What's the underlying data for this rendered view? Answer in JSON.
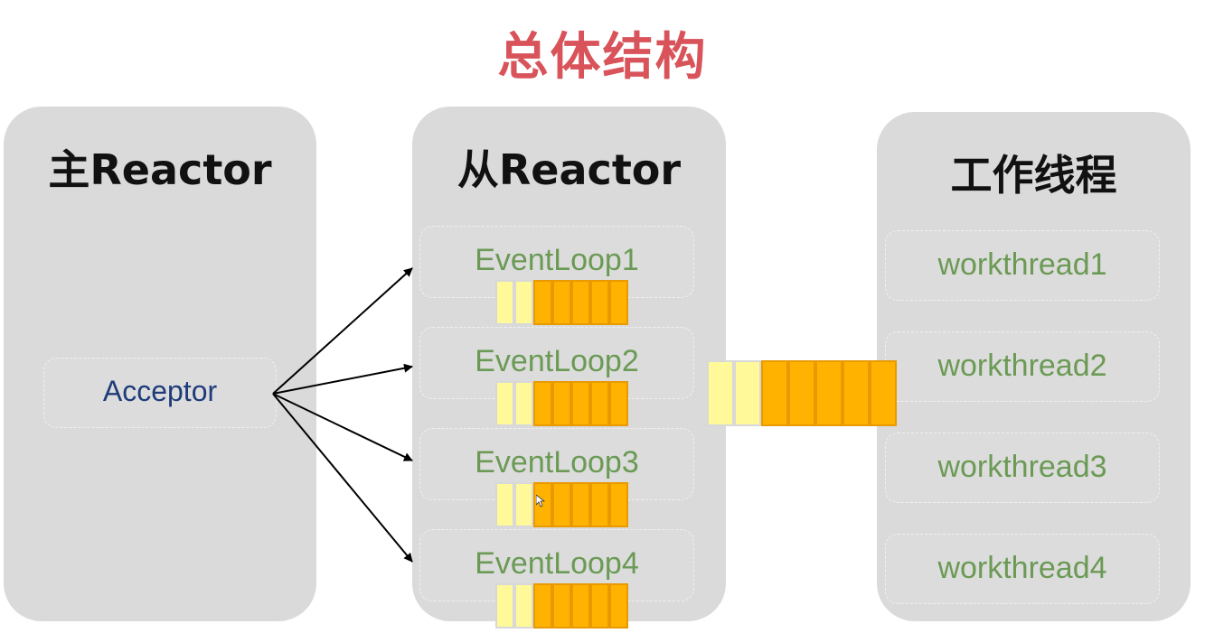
{
  "title": "总体结构",
  "main_reactor": {
    "title": "主Reactor",
    "acceptor": "Acceptor"
  },
  "sub_reactor": {
    "title": "从Reactor",
    "event_loops": [
      "EventLoop1",
      "EventLoop2",
      "EventLoop3",
      "EventLoop4"
    ]
  },
  "workers": {
    "title": "工作线程",
    "threads": [
      "workthread1",
      "workthread2",
      "workthread3",
      "workthread4"
    ]
  },
  "colors": {
    "title": "#d9535a",
    "panel": "#dadada",
    "queue_light": "#fff99a",
    "queue_dark": "#ffb300",
    "label_green": "#6b9a55",
    "label_blue": "#1f3c7a"
  }
}
